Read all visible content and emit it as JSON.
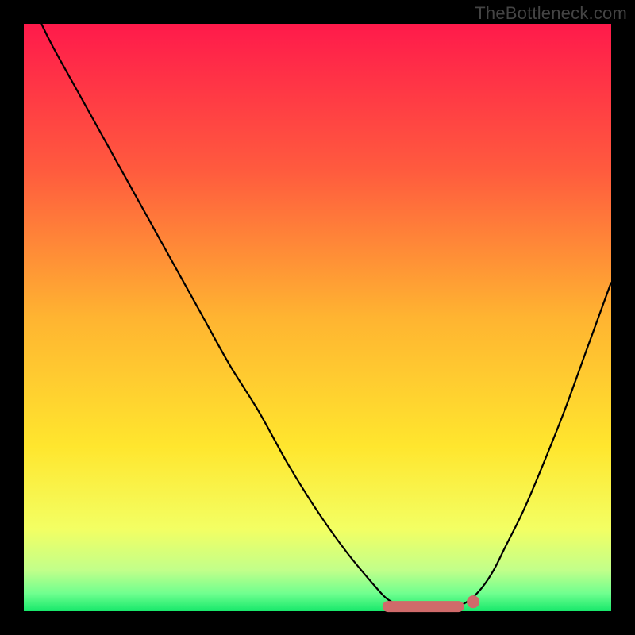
{
  "watermark": "TheBottleneck.com",
  "chart_data": {
    "type": "line",
    "title": "",
    "xlabel": "",
    "ylabel": "",
    "xlim": [
      0,
      100
    ],
    "ylim": [
      0,
      100
    ],
    "grid": false,
    "legend": false,
    "background": {
      "type": "vertical-gradient",
      "stops": [
        {
          "t": 0.0,
          "color": "#ff1a4b"
        },
        {
          "t": 0.25,
          "color": "#ff5b3e"
        },
        {
          "t": 0.5,
          "color": "#ffb431"
        },
        {
          "t": 0.72,
          "color": "#ffe62e"
        },
        {
          "t": 0.86,
          "color": "#f3ff63"
        },
        {
          "t": 0.93,
          "color": "#c2ff8a"
        },
        {
          "t": 0.97,
          "color": "#6fff8f"
        },
        {
          "t": 1.0,
          "color": "#17e86b"
        }
      ]
    },
    "series": [
      {
        "name": "bottleneck-curve",
        "color": "#000000",
        "x": [
          3,
          5,
          10,
          15,
          20,
          25,
          30,
          35,
          40,
          45,
          50,
          55,
          60,
          62,
          64,
          66,
          68,
          70,
          72,
          74,
          76,
          78,
          80,
          82,
          85,
          88,
          92,
          96,
          100
        ],
        "y": [
          100,
          96,
          87,
          78,
          69,
          60,
          51,
          42,
          34,
          25,
          17,
          10,
          4,
          2,
          1,
          0.5,
          0.3,
          0.2,
          0.3,
          0.8,
          2,
          4,
          7,
          11,
          17,
          24,
          34,
          45,
          56
        ]
      }
    ],
    "highlight": {
      "name": "optimal-zone",
      "color": "#d06a6a",
      "segment": {
        "x": [
          62,
          74
        ],
        "y": [
          0.8,
          0.8
        ]
      },
      "dot": {
        "x": 76.5,
        "y": 1.6
      }
    },
    "annotations": []
  }
}
